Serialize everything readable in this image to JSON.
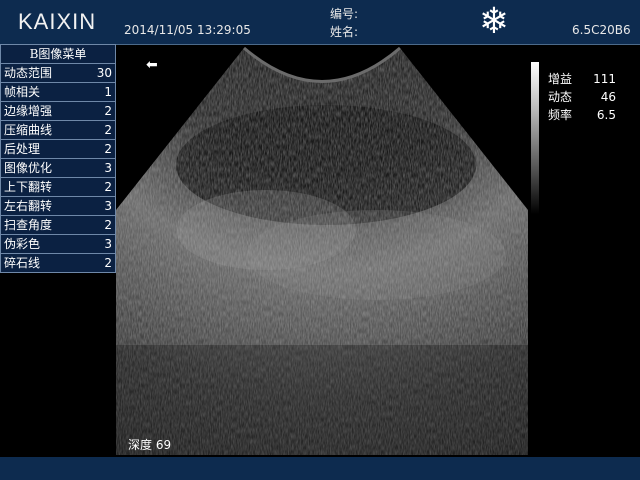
{
  "header": {
    "logo": "KAIXIN",
    "datetime": "2014/11/05  13:29:05",
    "patient_number_label": "编号:",
    "patient_name_label": "姓名:",
    "freeze_icon": "snowflake-icon",
    "probe": "6.5C20B6"
  },
  "menu": {
    "title": "B图像菜单",
    "items": [
      {
        "label": "动态范围",
        "value": "30"
      },
      {
        "label": "帧相关",
        "value": "1"
      },
      {
        "label": "边缘增强",
        "value": "2"
      },
      {
        "label": "压缩曲线",
        "value": "2"
      },
      {
        "label": "后处理",
        "value": "2"
      },
      {
        "label": "图像优化",
        "value": "3"
      },
      {
        "label": "上下翻转",
        "value": "2"
      },
      {
        "label": "左右翻转",
        "value": "3"
      },
      {
        "label": "扫查角度",
        "value": "2"
      },
      {
        "label": "伪彩色",
        "value": "3"
      },
      {
        "label": "碎石线",
        "value": "2"
      }
    ]
  },
  "image": {
    "orientation_icon": "left-arrow-icon",
    "depth": "深度 69"
  },
  "readout": [
    {
      "label": "增益",
      "value": "111"
    },
    {
      "label": "动态",
      "value": "46"
    },
    {
      "label": "频率",
      "value": "6.5"
    }
  ],
  "colors": {
    "header_bg": "#0d2b4f",
    "menu_bg": "#0b2142",
    "menu_border": "#6f88a8",
    "marker": "#7ee04a"
  }
}
